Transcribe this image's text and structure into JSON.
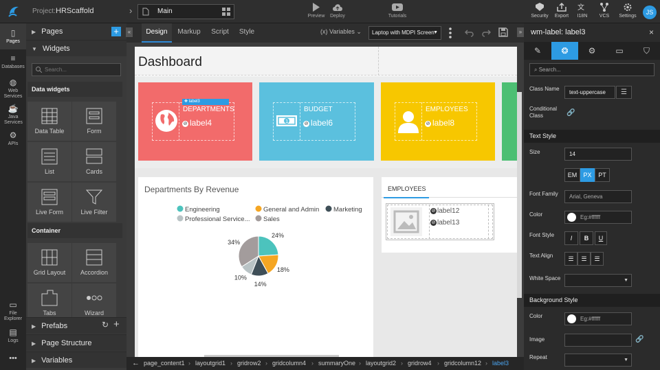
{
  "topbar": {
    "project_label": "Project:",
    "project_name": "HRScaffold",
    "page_name": "Main",
    "actions": [
      {
        "label": "Preview",
        "icon": "play-icon"
      },
      {
        "label": "Deploy",
        "icon": "cloud-upload-icon"
      },
      {
        "label": "Tutorials",
        "icon": "video-icon"
      }
    ],
    "right_actions": [
      {
        "label": "Security"
      },
      {
        "label": "Export"
      },
      {
        "label": "I18N"
      },
      {
        "label": "VCS"
      },
      {
        "label": "Settings"
      }
    ],
    "avatar_initials": "JS"
  },
  "leftrail": {
    "items": [
      {
        "label": "Pages"
      },
      {
        "label": "Databases"
      },
      {
        "label": "Web Services"
      },
      {
        "label": "Java Services"
      },
      {
        "label": "APIs"
      },
      {
        "label": "File Explorer"
      },
      {
        "label": "Logs"
      }
    ],
    "more": "•••"
  },
  "widgets": {
    "pages_label": "Pages",
    "widgets_label": "Widgets",
    "search_placeholder": "Search...",
    "data_section": "Data widgets",
    "container_section": "Container",
    "data_items": [
      "Data Table",
      "Form",
      "List",
      "Cards",
      "Live Form",
      "Live Filter"
    ],
    "container_items": [
      "Grid Layout",
      "Accordion",
      "Tabs",
      "Wizard"
    ],
    "prefabs_label": "Prefabs",
    "page_structure_label": "Page Structure",
    "variables_label": "Variables"
  },
  "editor": {
    "tabs": [
      "Design",
      "Markup",
      "Script",
      "Style"
    ],
    "variables_label": "Variables",
    "device_label": "Laptop with MDPI Screen"
  },
  "canvas": {
    "title": "Dashboard",
    "selected_label": "label3",
    "tiles": [
      {
        "title": "DEPARTMENTS",
        "value": "label4",
        "color": "#f26b6b"
      },
      {
        "title": "BUDGET",
        "value": "label6",
        "color": "#5bc0de"
      },
      {
        "title": "EMPLOYEES",
        "value": "label8",
        "color": "#f7c700"
      }
    ],
    "chart_panel_title": "Departments By Revenue",
    "employees_tab": "EMPLOYEES",
    "employee_labels": [
      "label12",
      "label13"
    ]
  },
  "chart_data": {
    "type": "pie",
    "categories": [
      "Engineering",
      "General and Admin",
      "Marketing",
      "Professional Service...",
      "Sales"
    ],
    "values": [
      24,
      18,
      14,
      10,
      34
    ],
    "colors": [
      "#4cc3bd",
      "#f5a623",
      "#3f4f58",
      "#b9c3c5",
      "#a39c9c"
    ],
    "data_labels": [
      "24%",
      "18%",
      "14%",
      "10%",
      "34%"
    ],
    "legend_position": "top"
  },
  "breadcrumb": [
    "page_content1",
    "layoutgrid1",
    "gridrow2",
    "gridcolumn4",
    "summaryOne",
    "layoutgrid2",
    "gridrow4",
    "gridcolumn12",
    "label3"
  ],
  "props": {
    "title": "wm-label: label3",
    "search_placeholder": "Search...",
    "class_name_label": "Class Name",
    "class_name_value": "text-uppercase",
    "conditional_class_label": "Conditional Class",
    "text_style_section": "Text Style",
    "size_label": "Size",
    "size_value": "14",
    "units": [
      "EM",
      "PX",
      "PT"
    ],
    "active_unit": "PX",
    "font_family_label": "Font Family",
    "font_family_value": "Arial, Geneva",
    "color_label": "Color",
    "color_placeholder": "Eg:#ffffff",
    "font_style_label": "Font Style",
    "text_align_label": "Text Align",
    "white_space_label": "White Space",
    "background_section": "Background Style",
    "bg_color_label": "Color",
    "bg_color_placeholder": "Eg:#ffffff",
    "image_label": "Image",
    "repeat_label": "Repeat"
  }
}
